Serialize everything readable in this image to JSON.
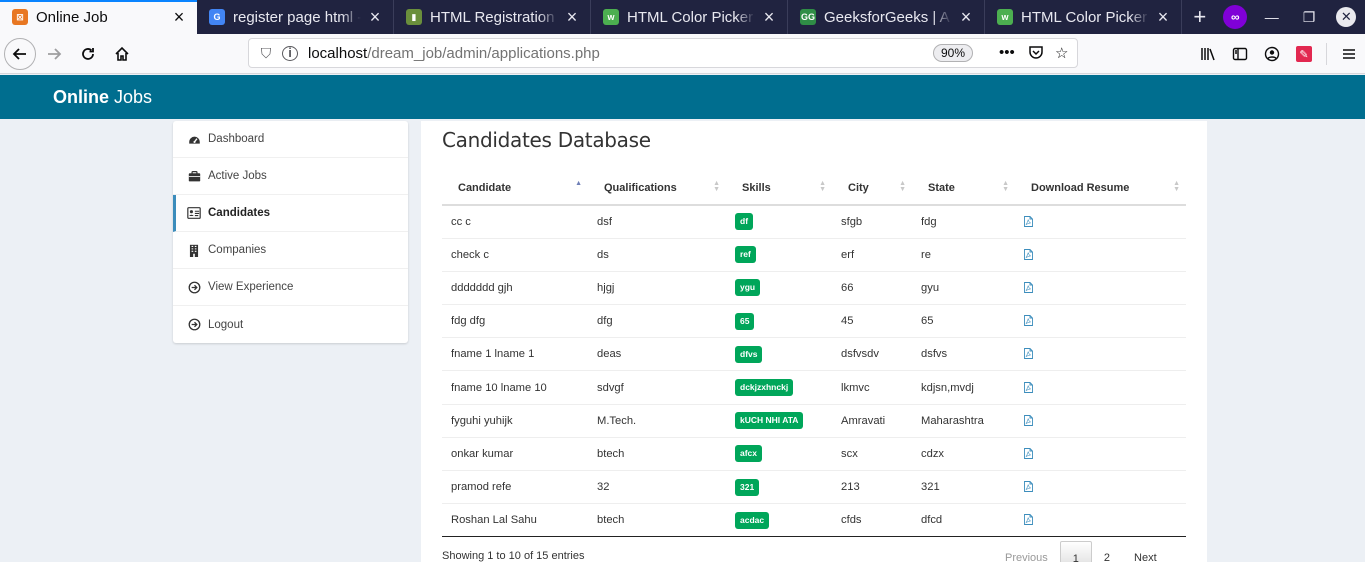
{
  "browser": {
    "tabs": [
      {
        "title": "Online Job",
        "active": true,
        "favicon_color": "#e87722",
        "favicon_glyph": "⊠"
      },
      {
        "title": "register page html - G",
        "active": false,
        "favicon_color": "#4285f4",
        "favicon_glyph": "G"
      },
      {
        "title": "HTML Registration F",
        "active": false,
        "favicon_color": "#6a8f3c",
        "favicon_glyph": "▮"
      },
      {
        "title": "HTML Color Picker",
        "active": false,
        "favicon_color": "#4caf50",
        "favicon_glyph": "w"
      },
      {
        "title": "GeeksforGeeks | A cc",
        "active": false,
        "favicon_color": "#2f8d46",
        "favicon_glyph": "GG"
      },
      {
        "title": "HTML Color Picker",
        "active": false,
        "favicon_color": "#4caf50",
        "favicon_glyph": "w"
      }
    ],
    "url_host": "localhost",
    "url_path": "/dream_job/admin/applications.php",
    "zoom": "90%"
  },
  "header": {
    "brand_bold": "Online",
    "brand_rest": " Jobs"
  },
  "sidebar": {
    "items": [
      {
        "label": "Dashboard",
        "icon": "dashboard-icon",
        "active": false
      },
      {
        "label": "Active Jobs",
        "icon": "briefcase-icon",
        "active": false
      },
      {
        "label": "Candidates",
        "icon": "id-card-icon",
        "active": true
      },
      {
        "label": "Companies",
        "icon": "building-icon",
        "active": false
      },
      {
        "label": "View Experience",
        "icon": "circle-arrow-icon",
        "active": false
      },
      {
        "label": "Logout",
        "icon": "circle-arrow-icon",
        "active": false
      }
    ]
  },
  "main": {
    "title": "Candidates Database",
    "columns": [
      "Candidate",
      "Qualifications",
      "Skills",
      "City",
      "State",
      "Download Resume"
    ],
    "rows": [
      {
        "candidate": "cc c",
        "qualifications": "dsf",
        "skills": "df",
        "city": "sfgb",
        "state": "fdg"
      },
      {
        "candidate": "check c",
        "qualifications": "ds",
        "skills": "ref",
        "city": "erf",
        "state": "re"
      },
      {
        "candidate": "ddddddd gjh",
        "qualifications": "hjgj",
        "skills": "ygu",
        "city": "66",
        "state": "gyu"
      },
      {
        "candidate": "fdg dfg",
        "qualifications": "dfg",
        "skills": "65",
        "city": "45",
        "state": "65"
      },
      {
        "candidate": "fname 1 lname 1",
        "qualifications": "deas",
        "skills": "dfvs",
        "city": "dsfvsdv",
        "state": "dsfvs"
      },
      {
        "candidate": "fname 10 lname 10",
        "qualifications": "sdvgf",
        "skills": "dckjzxhnckj",
        "city": "lkmvc",
        "state": "kdjsn,mvdj"
      },
      {
        "candidate": "fyguhi yuhijk",
        "qualifications": "M.Tech.",
        "skills": "kUCH NHI ATA",
        "city": "Amravati",
        "state": "Maharashtra"
      },
      {
        "candidate": "onkar kumar",
        "qualifications": "btech",
        "skills": "afcx",
        "city": "scx",
        "state": "cdzx"
      },
      {
        "candidate": "pramod refe",
        "qualifications": "32",
        "skills": "321",
        "city": "213",
        "state": "321"
      },
      {
        "candidate": "Roshan Lal Sahu",
        "qualifications": "btech",
        "skills": "acdac",
        "city": "cfds",
        "state": "dfcd"
      }
    ],
    "info": "Showing 1 to 10 of 15 entries",
    "pagination": {
      "previous": "Previous",
      "pages": [
        "1",
        "2"
      ],
      "current": "1",
      "next": "Next"
    }
  },
  "colors": {
    "header": "#006e8f",
    "skill_badge": "#00a65a",
    "active_border": "#3c8dbc",
    "pdf_icon": "#3c8dbc"
  }
}
